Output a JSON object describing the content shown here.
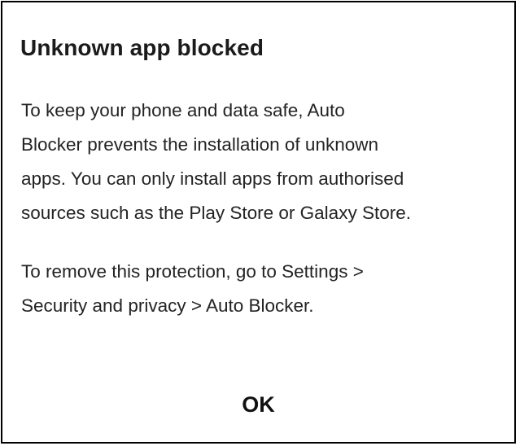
{
  "dialog": {
    "title": "Unknown app blocked",
    "message_paragraph_1": "To keep your phone and data safe, Auto\nBlocker prevents the installation of unknown\napps. You can only install apps from authorised\nsources such as the Play Store or Galaxy Store.",
    "message_paragraph_2": "To remove this protection, go to Settings >\nSecurity and privacy > Auto Blocker.",
    "ok_label": "OK"
  }
}
